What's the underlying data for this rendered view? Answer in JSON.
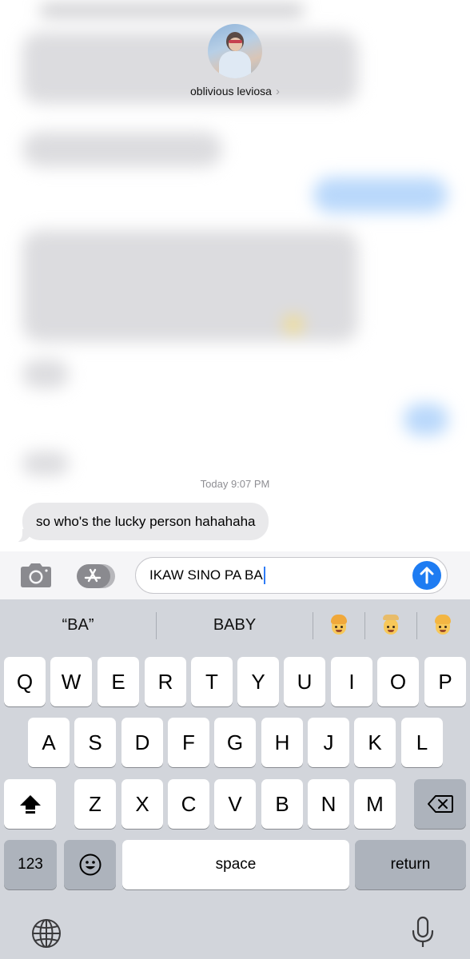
{
  "contact": {
    "name": "oblivious leviosa",
    "chevron": "›"
  },
  "conversation": {
    "timestamp": "Today 9:07 PM",
    "incoming_message": "so who's the lucky person hahahaha"
  },
  "compose": {
    "text": "IKAW SINO PA BA",
    "camera_icon": "camera-icon",
    "apps_icon": "app-store-icon",
    "send_icon": "arrow-up-icon",
    "send_color": "#1e7cf2"
  },
  "suggestions": [
    {
      "label": "“BA”"
    },
    {
      "label": "BABY"
    }
  ],
  "emoji_suggestions": [
    "person-blond-emoji",
    "older-man-emoji",
    "blond-child-emoji"
  ],
  "keyboard": {
    "row1": [
      "Q",
      "W",
      "E",
      "R",
      "T",
      "Y",
      "U",
      "I",
      "O",
      "P"
    ],
    "row2": [
      "A",
      "S",
      "D",
      "F",
      "G",
      "H",
      "J",
      "K",
      "L"
    ],
    "row3": [
      "Z",
      "X",
      "C",
      "V",
      "B",
      "N",
      "M"
    ],
    "numbers_label": "123",
    "space_label": "space",
    "return_label": "return"
  }
}
